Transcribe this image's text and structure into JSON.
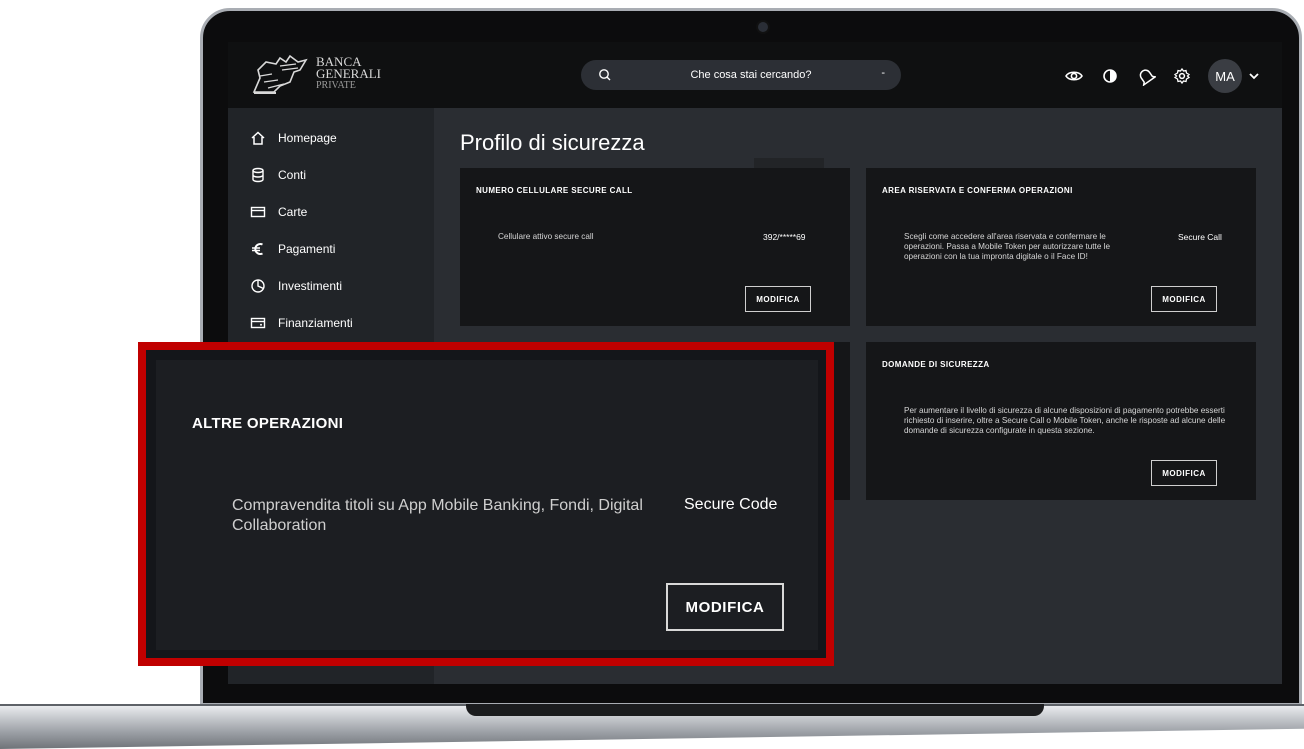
{
  "header": {
    "logo_line1": "BANCA",
    "logo_line2": "GENERALI",
    "logo_line3": "PRIVATE",
    "search_placeholder": "Che cosa stai cercando?",
    "search_trailing": "-",
    "avatar_initials": "MA",
    "icons": [
      "eye-icon",
      "contrast-icon",
      "bell-icon",
      "gear-icon",
      "chevron-down-icon"
    ]
  },
  "sidebar": {
    "items": [
      {
        "label": "Homepage",
        "icon": "home-icon"
      },
      {
        "label": "Conti",
        "icon": "database-icon"
      },
      {
        "label": "Carte",
        "icon": "card-icon"
      },
      {
        "label": "Pagamenti",
        "icon": "euro-icon"
      },
      {
        "label": "Investimenti",
        "icon": "pie-chart-icon"
      },
      {
        "label": "Finanziamenti",
        "icon": "loan-icon"
      }
    ]
  },
  "main": {
    "title": "Profilo di sicurezza",
    "cards": [
      {
        "title": "NUMERO CELLULARE SECURE CALL",
        "description": "Cellulare attivo secure call",
        "value": "392/*****69",
        "button": "MODIFICA"
      },
      {
        "title": "AREA RISERVATA E CONFERMA OPERAZIONI",
        "description": "Scegli come accedere all'area riservata e confermare le operazioni. Passa a Mobile Token per autorizzare tutte le operazioni con la tua impronta digitale o il Face ID!",
        "value": "Secure Call",
        "button": "MODIFICA"
      },
      {
        "title": "DOMANDE DI SICUREZZA",
        "description": "Per aumentare il livello di sicurezza di alcune disposizioni di pagamento potrebbe esserti richiesto di inserire, oltre a Secure Call o Mobile Token, anche le risposte ad alcune delle domande di sicurezza configurate in questa sezione.",
        "value": "",
        "button": "MODIFICA"
      }
    ]
  },
  "callout": {
    "title": "ALTRE OPERAZIONI",
    "description": "Compravendita titoli su App Mobile Banking, Fondi, Digital Collaboration",
    "value": "Secure Code",
    "button": "MODIFICA"
  },
  "colors": {
    "highlight_border": "#c00000",
    "topbar": "#0f1011",
    "sidebar": "#212428",
    "card": "#151618"
  }
}
